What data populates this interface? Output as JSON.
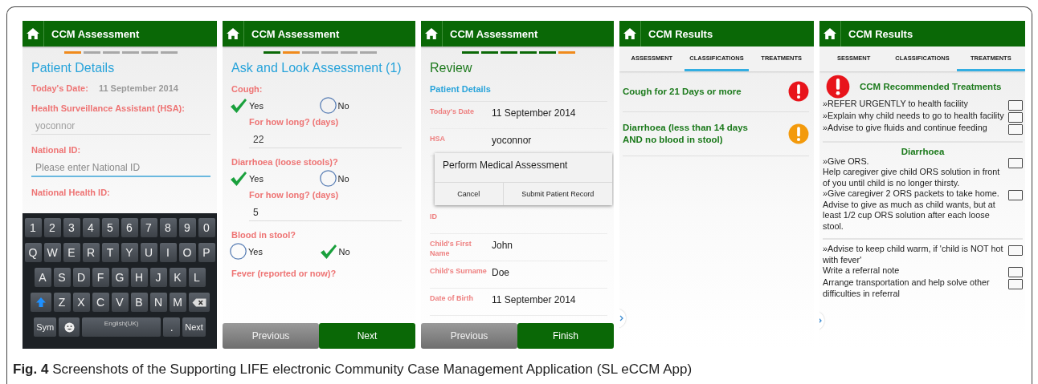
{
  "patient_screen": {
    "title": "CCM Assessment",
    "steps": [
      {
        "done": false,
        "current": true
      },
      {
        "done": false,
        "current": false
      },
      {
        "done": false,
        "current": false
      },
      {
        "done": false,
        "current": false
      },
      {
        "done": false,
        "current": false
      },
      {
        "done": false,
        "current": false
      }
    ],
    "heading": "Patient Details",
    "date_label": "Today's Date:",
    "date_value": "11 September 2014",
    "fields": [
      {
        "label": "Health Surveillance Assistant (HSA):",
        "value": "yoconnor",
        "disabled": true,
        "focused": false
      },
      {
        "label": "National ID:",
        "placeholder": "Please enter National ID",
        "disabled": false,
        "focused": true
      },
      {
        "label": "National Health ID:"
      }
    ],
    "keyboard": [
      [
        {
          "kind": "char",
          "label": "1"
        },
        {
          "kind": "char",
          "label": "2"
        },
        {
          "kind": "char",
          "label": "3"
        },
        {
          "kind": "char",
          "label": "4"
        },
        {
          "kind": "char",
          "label": "5"
        },
        {
          "kind": "char",
          "label": "6"
        },
        {
          "kind": "char",
          "label": "7"
        },
        {
          "kind": "char",
          "label": "8"
        },
        {
          "kind": "char",
          "label": "9"
        },
        {
          "kind": "char",
          "label": "0"
        }
      ],
      [
        {
          "kind": "char",
          "label": "Q"
        },
        {
          "kind": "char",
          "label": "W"
        },
        {
          "kind": "char",
          "label": "E"
        },
        {
          "kind": "char",
          "label": "R"
        },
        {
          "kind": "char",
          "label": "T"
        },
        {
          "kind": "char",
          "label": "Y"
        },
        {
          "kind": "char",
          "label": "U"
        },
        {
          "kind": "char",
          "label": "I"
        },
        {
          "kind": "char",
          "label": "O"
        },
        {
          "kind": "char",
          "label": "P"
        }
      ],
      [
        {
          "kind": "char",
          "label": "A"
        },
        {
          "kind": "char",
          "label": "S"
        },
        {
          "kind": "char",
          "label": "D"
        },
        {
          "kind": "char",
          "label": "F"
        },
        {
          "kind": "char",
          "label": "G"
        },
        {
          "kind": "char",
          "label": "H"
        },
        {
          "kind": "char",
          "label": "J"
        },
        {
          "kind": "char",
          "label": "K"
        },
        {
          "kind": "char",
          "label": "L"
        }
      ],
      [
        {
          "kind": "shift"
        },
        {
          "kind": "char",
          "label": "Z"
        },
        {
          "kind": "char",
          "label": "X"
        },
        {
          "kind": "char",
          "label": "C"
        },
        {
          "kind": "char",
          "label": "V"
        },
        {
          "kind": "char",
          "label": "B"
        },
        {
          "kind": "char",
          "label": "N"
        },
        {
          "kind": "char",
          "label": "M"
        },
        {
          "kind": "backspace"
        }
      ],
      [
        {
          "kind": "wide",
          "label": "Sym"
        },
        {
          "kind": "emoji"
        },
        {
          "kind": "space",
          "label": "English(UK)"
        },
        {
          "kind": "char",
          "label": "."
        },
        {
          "kind": "wide",
          "label": "Next"
        }
      ]
    ]
  },
  "assessment_screen": {
    "title": "CCM Assessment",
    "steps": [
      {
        "done": true,
        "current": false
      },
      {
        "done": false,
        "current": true
      },
      {
        "done": false,
        "current": false
      },
      {
        "done": false,
        "current": false
      },
      {
        "done": false,
        "current": false
      },
      {
        "done": false,
        "current": false
      }
    ],
    "heading": "Ask and Look Assessment (1)",
    "questions": [
      {
        "label": "Cough:",
        "options": [
          {
            "label": "Yes",
            "selected": true
          },
          {
            "label": "No",
            "selected": false
          }
        ],
        "followup": {
          "label": "For how long? (days)",
          "value": "22"
        }
      },
      {
        "label": "Diarrhoea (loose stools)?",
        "options": [
          {
            "label": "Yes",
            "selected": true
          },
          {
            "label": "No",
            "selected": false
          }
        ],
        "followup": {
          "label": "For how long? (days)",
          "value": "5"
        }
      },
      {
        "label": "Blood in stool?",
        "options": [
          {
            "label": "Yes",
            "selected": false
          },
          {
            "label": "No",
            "selected": true
          }
        ]
      },
      {
        "label": "Fever (reported or now)?"
      }
    ],
    "buttons": [
      {
        "label": "Previous",
        "kind": "secondary"
      },
      {
        "label": "Next",
        "kind": "primary"
      }
    ]
  },
  "review_screen": {
    "title": "CCM Assessment",
    "steps": [
      {
        "done": true,
        "current": false
      },
      {
        "done": true,
        "current": false
      },
      {
        "done": true,
        "current": false
      },
      {
        "done": true,
        "current": false
      },
      {
        "done": true,
        "current": false
      },
      {
        "done": false,
        "current": true
      }
    ],
    "heading": "Review",
    "subheading": "Patient Details",
    "rows_before": [
      {
        "label": "Today's Date",
        "value": "11 September 2014"
      },
      {
        "label": "HSA",
        "value": "yoconnor"
      }
    ],
    "dialog": {
      "title": "Perform Medical Assessment",
      "buttons": [
        "Cancel",
        "Submit Patient Record"
      ]
    },
    "rows_after": [
      {
        "label": "ID"
      },
      {
        "label": "Child's First Name",
        "value": "John"
      },
      {
        "label": "Child's Surname",
        "value": "Doe"
      },
      {
        "label": "Date of Birth",
        "value": "11 September 2014"
      }
    ],
    "buttons": [
      {
        "label": "Previous",
        "kind": "secondary"
      },
      {
        "label": "Finish",
        "kind": "primary"
      }
    ]
  },
  "classifications_screen": {
    "title": "CCM Results",
    "tabs": [
      {
        "label": "ASSESSMENT",
        "selected": false
      },
      {
        "label": "CLASSIFICATIONS",
        "selected": true
      },
      {
        "label": "TREATMENTS",
        "selected": false
      }
    ],
    "items": [
      {
        "text": "Cough for 21 Days or more",
        "color": "#e8141b"
      },
      {
        "text": "Diarrhoea (less than 14 days AND no blood in stool)",
        "color": "#f39a0c"
      }
    ]
  },
  "treatments_screen": {
    "title": "CCM Results",
    "tabs": [
      {
        "label": "SESSMENT",
        "selected": false
      },
      {
        "label": "CLASSIFICATIONS",
        "selected": false
      },
      {
        "label": "TREATMENTS",
        "selected": true
      }
    ],
    "heading": "CCM Recommended Treatments",
    "sections": [
      {
        "items": [
          {
            "text": "»REFER URGENTLY to health facility",
            "checked": false
          },
          {
            "text": "»Explain why child needs to go to health facility",
            "checked": false
          },
          {
            "text": "»Advise to give fluids and continue feeding",
            "checked": false
          }
        ]
      },
      {
        "title": "Diarrhoea",
        "items": [
          {
            "text": "»Give ORS.\nHelp caregiver give child ORS solution in front of you until child is no longer thirsty.",
            "checked": false
          },
          {
            "text": "»Give caregiver 2 ORS packets to take home.\nAdvise to give as much as child wants, but at least 1/2 cup ORS solution after each loose stool.",
            "checked": false
          }
        ]
      },
      {
        "items": [
          {
            "text": "»Advise to keep child warm, if 'child is NOT hot with fever'",
            "checked": false
          },
          {
            "text": "Write a referral note",
            "checked": false
          },
          {
            "text": "Arrange transportation and help solve other difficulties in referral",
            "checked": false
          }
        ]
      }
    ]
  },
  "caption": "**Fig. 4** Screenshots of the Supporting LIFE electronic Community Case Management Application (SL eCCM App)"
}
